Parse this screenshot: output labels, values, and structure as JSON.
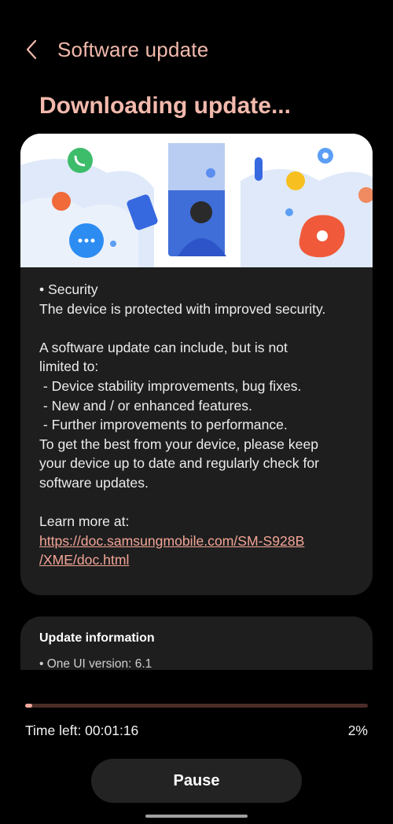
{
  "header": {
    "title": "Software update"
  },
  "status": {
    "heading": "Downloading update..."
  },
  "release_notes": {
    "lines": [
      "• Security",
      "The device is protected with improved security.",
      "",
      "A software update can include, but is not",
      "limited to:",
      " - Device stability improvements, bug fixes.",
      " - New and / or enhanced features.",
      " - Further improvements to performance.",
      "To get the best from your device, please keep",
      "your device up to date and regularly check for",
      "software updates.",
      "",
      "Learn more at:"
    ],
    "link_line1": "https://doc.samsungmobile.com/SM-S928B",
    "link_line2": "/XME/doc.html"
  },
  "update_info": {
    "title": "Update information",
    "item": "• One UI version: 6.1"
  },
  "progress": {
    "fraction": 0.02,
    "time_left": "Time left: 00:01:16",
    "percent": "2%"
  },
  "actions": {
    "pause_label": "Pause"
  },
  "colors": {
    "accent": "#f2b9ac",
    "link": "#f3a596",
    "card_bg": "#1e1e1e",
    "progress_fill": "#f2a79a",
    "progress_track": "#4b2d28"
  },
  "icons": [
    "back-arrow-icon",
    "phone-icon",
    "chat-bubble-icon",
    "settings-icon",
    "flower-icon"
  ]
}
